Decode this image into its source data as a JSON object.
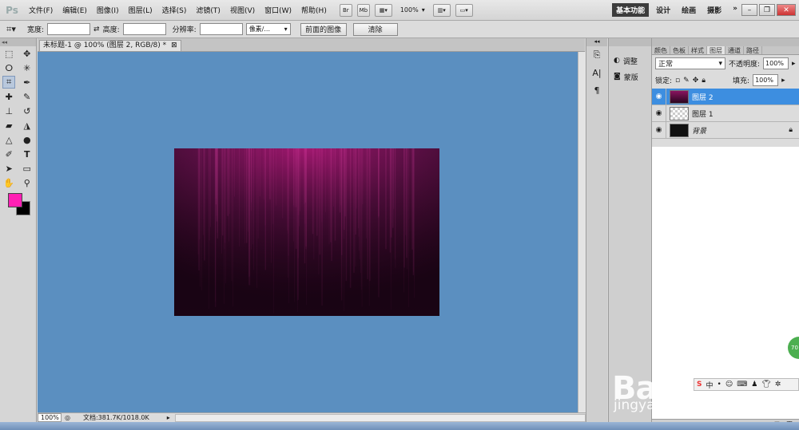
{
  "app": {
    "logo": "Ps"
  },
  "menu": [
    "文件(F)",
    "编辑(E)",
    "图像(I)",
    "图层(L)",
    "选择(S)",
    "滤镜(T)",
    "视图(V)",
    "窗口(W)",
    "帮助(H)"
  ],
  "menubar_buttons": {
    "br": "Br",
    "mb": "Mb",
    "zoom": "100%"
  },
  "workspaces": [
    "基本功能",
    "设计",
    "绘画",
    "摄影"
  ],
  "workspaces_more": "»",
  "options": {
    "width_label": "宽度:",
    "height_label": "高度:",
    "resolution_label": "分辨率:",
    "unit_value": "像素/...",
    "front_image_button": "前面的图像",
    "clear_button": "清除"
  },
  "document": {
    "tab_title": "未标题-1 @ 100% (图层 2, RGB/8) *",
    "zoom": "100%",
    "doc_info": "文档:381.7K/1018.0K"
  },
  "colors": {
    "canvas_bg": "#5b8fc0",
    "foreground": "#ff1fb4",
    "background": "#000000",
    "layer_selected": "#3d8ee0"
  },
  "adjust_panel": {
    "adjust_label": "调整",
    "mask_label": "蒙版"
  },
  "layers_panel": {
    "tabs": [
      "颜色",
      "色板",
      "样式",
      "图层",
      "通道",
      "路径"
    ],
    "active_tab": "图层",
    "blend_mode": "正常",
    "opacity_label": "不透明度:",
    "opacity_value": "100%",
    "lock_label": "锁定:",
    "fill_label": "填充:",
    "fill_value": "100%",
    "layers": [
      {
        "name": "图层 2",
        "selected": true
      },
      {
        "name": "图层 1",
        "selected": false
      },
      {
        "name": "背景",
        "selected": false
      }
    ]
  },
  "watermark": {
    "brand": "Baidu经验",
    "url": "jingyan.baidu.com"
  },
  "badge": "70"
}
